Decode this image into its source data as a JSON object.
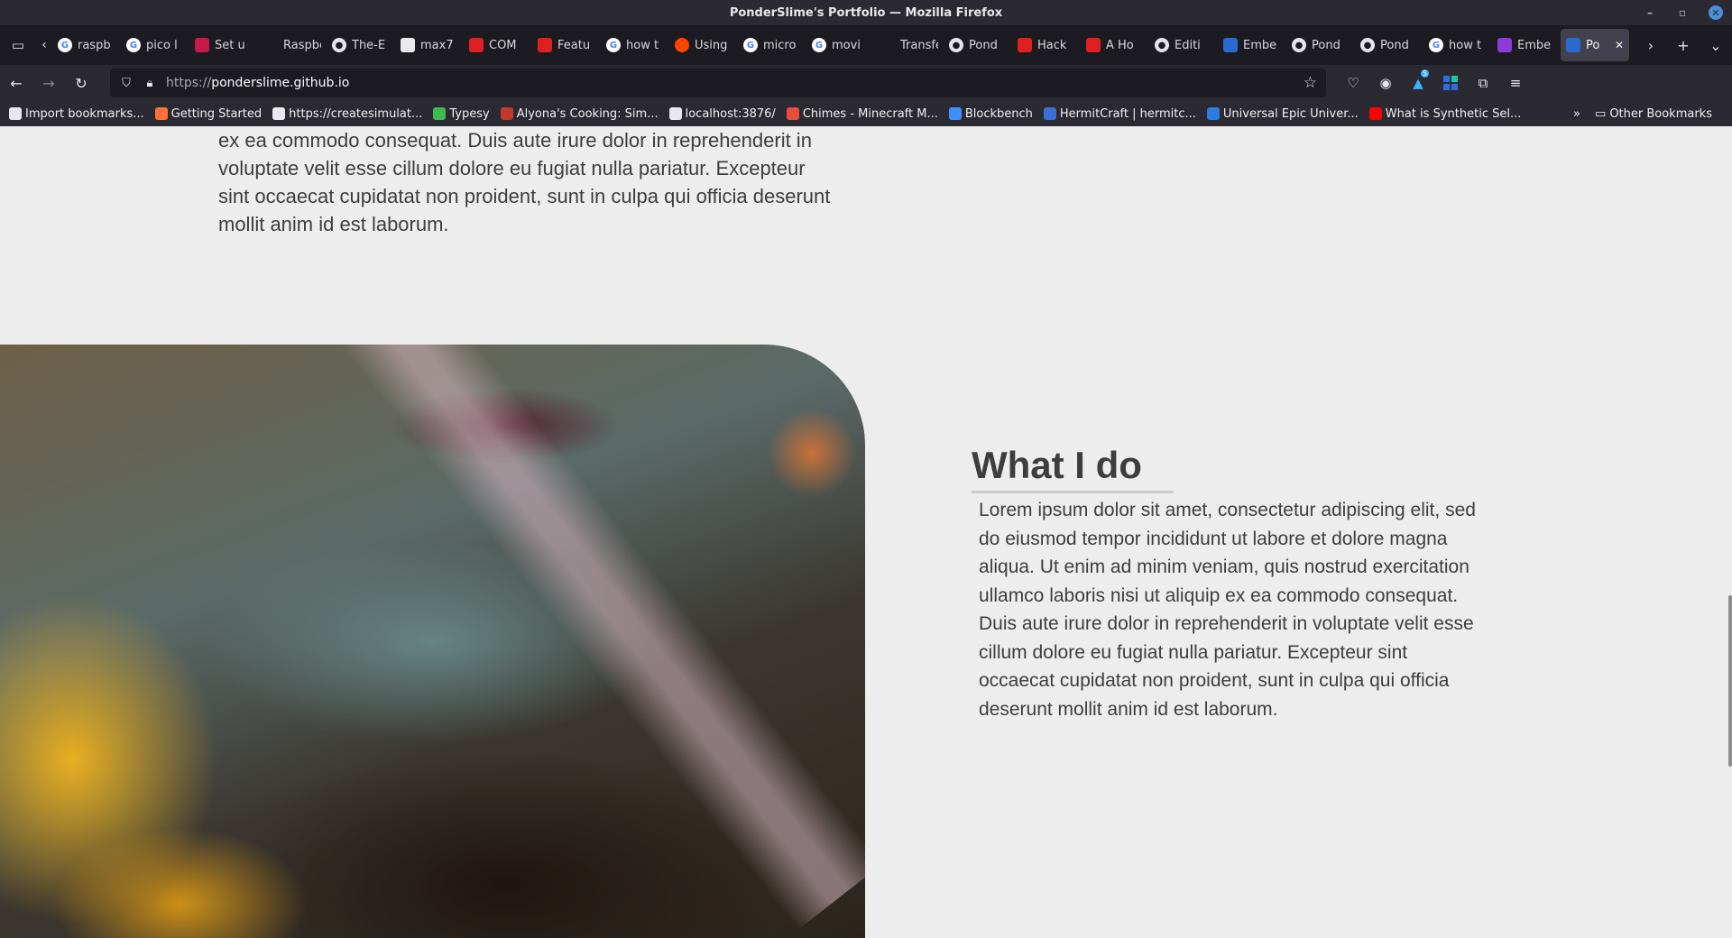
{
  "window": {
    "title": "PonderSlime's Portfolio — Mozilla Firefox",
    "minimize_glyph": "–",
    "maximize_glyph": "▫",
    "close_glyph": "✕"
  },
  "tabs": [
    {
      "label": "raspb",
      "icon": "google-icon",
      "fav": "google"
    },
    {
      "label": "pico l",
      "icon": "google-icon",
      "fav": "google"
    },
    {
      "label": "Set u",
      "icon": "raspberry-pi-icon",
      "fav": "rasp"
    },
    {
      "label": "Raspberr",
      "icon": "none",
      "fav": "none"
    },
    {
      "label": "The-E",
      "icon": "github-icon",
      "fav": "github"
    },
    {
      "label": "max7",
      "icon": "box-icon",
      "fav": "box"
    },
    {
      "label": "COM",
      "icon": "red-square-icon",
      "fav": "red"
    },
    {
      "label": "Featu",
      "icon": "red-flag-icon",
      "fav": "red"
    },
    {
      "label": "how t",
      "icon": "google-icon",
      "fav": "google"
    },
    {
      "label": "Using",
      "icon": "reddit-icon",
      "fav": "reddit"
    },
    {
      "label": "micro",
      "icon": "google-icon",
      "fav": "google"
    },
    {
      "label": "movi",
      "icon": "google-icon",
      "fav": "google"
    },
    {
      "label": "Transfer",
      "icon": "none",
      "fav": "none"
    },
    {
      "label": "Pond",
      "icon": "github-icon",
      "fav": "github"
    },
    {
      "label": "Hack",
      "icon": "hackster-icon",
      "fav": "red"
    },
    {
      "label": "A Ho",
      "icon": "hackster-icon",
      "fav": "red"
    },
    {
      "label": "Editi",
      "icon": "github-icon",
      "fav": "github"
    },
    {
      "label": "Embe",
      "icon": "blue-grid-icon",
      "fav": "blue"
    },
    {
      "label": "Pond",
      "icon": "github-icon",
      "fav": "github"
    },
    {
      "label": "Pond",
      "icon": "github-icon",
      "fav": "github"
    },
    {
      "label": "how t",
      "icon": "google-icon",
      "fav": "google"
    },
    {
      "label": "Embe",
      "icon": "purple-icon",
      "fav": "purple"
    },
    {
      "label": "Po",
      "icon": "portfolio-icon",
      "fav": "blue",
      "active": true
    }
  ],
  "navbar": {
    "url_protocol": "https://",
    "url_host": "ponderslime.github.io",
    "extension_badge": "5"
  },
  "bookmarks": [
    {
      "label": "Import bookmarks...",
      "color": "#e8e8ee"
    },
    {
      "label": "Getting Started",
      "color": "#ff7139"
    },
    {
      "label": "https://createsimulat...",
      "color": "#e8e8ee"
    },
    {
      "label": "Typesy",
      "color": "#3fb950"
    },
    {
      "label": "Alyona's Cooking: Sim...",
      "color": "#c0392b"
    },
    {
      "label": "localhost:3876/",
      "color": "#e8e8ee"
    },
    {
      "label": "Chimes - Minecraft M...",
      "color": "#e74c3c"
    },
    {
      "label": "Blockbench",
      "color": "#3e90ff"
    },
    {
      "label": "HermitCraft | hermitc...",
      "color": "#3b6fd1"
    },
    {
      "label": "Universal Epic Univer...",
      "color": "#2a7de1"
    },
    {
      "label": "What is Synthetic Sel...",
      "color": "#ff0000"
    }
  ],
  "bookmarks_other": "Other Bookmarks",
  "page": {
    "intro_text": "ex ea commodo consequat. Duis aute irure dolor in reprehenderit in voluptate velit esse cillum dolore eu fugiat nulla pariatur. Excepteur sint occaecat cupidatat non proident, sunt in culpa qui officia deserunt mollit anim id est laborum.",
    "section_heading": "What I do",
    "section_text": "Lorem ipsum dolor sit amet, consectetur adipiscing elit, sed do eiusmod tempor incididunt ut labore et dolore magna aliqua. Ut enim ad minim veniam, quis nostrud exercitation ullamco laboris nisi ut aliquip ex ea commodo consequat. Duis aute irure dolor in reprehenderit in voluptate velit esse cillum dolore eu fugiat nulla pariatur. Excepteur sint occaecat cupidatat non proident, sunt in culpa qui officia deserunt mollit anim id est laborum."
  },
  "colors": {
    "page_bg": "#ededed",
    "text": "#3d3d3d",
    "chrome_dark": "#1c1b22",
    "chrome": "#2b2a33"
  }
}
